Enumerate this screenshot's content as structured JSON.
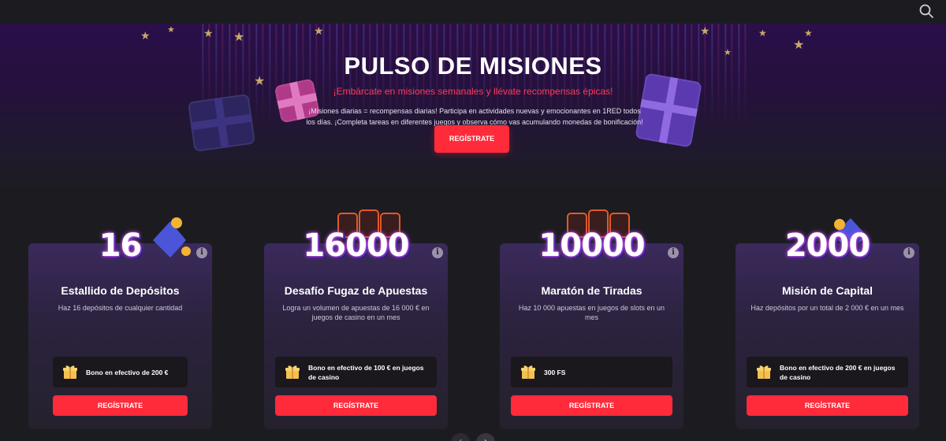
{
  "icons": {
    "search": "search-icon",
    "info": "info-icon",
    "gift": "gift-icon",
    "chevron_left": "chevron-left-icon",
    "chevron_right": "chevron-right-icon"
  },
  "colors": {
    "accent": "#ff2b3a",
    "subtitle": "#ff3b5c",
    "background": "#1c1c20",
    "hero_top": "#2a0f4a"
  },
  "hero": {
    "title": "PULSO DE MISIONES",
    "subtitle": "¡Embárcate en misiones semanales y llévate recompensas épicas!",
    "description": "¡Misiones diarias = recompensas diarias! Participa en actividades nuevas y emocionantes en 1RED todos los días. ¡Completa tareas en diferentes juegos y observa cómo vas acumulando monedas de bonificación!",
    "cta_label": "REGÍSTRATE"
  },
  "missions": [
    {
      "badge": "16",
      "title": "Estallido de Depósitos",
      "description": "Haz 16 depósitos de cualquier cantidad",
      "reward": "Bono en efectivo de 200 €",
      "cta_label": "REGÍSTRATE"
    },
    {
      "badge": "16000",
      "title": "Desafío Fugaz de Apuestas",
      "description": "Logra un volumen de apuestas de 16 000 € en juegos de casino en un mes",
      "reward": "Bono en efectivo de 100 € en juegos de casino",
      "cta_label": "REGÍSTRATE"
    },
    {
      "badge": "10000",
      "title": "Maratón de Tiradas",
      "description": "Haz 10 000 apuestas en juegos de slots en un mes",
      "reward": "300 FS",
      "cta_label": "REGÍSTRATE"
    },
    {
      "badge": "2000",
      "title": "Misión de Capital",
      "description": "Haz depósitos por un total de 2 000 € en un mes",
      "reward": "Bono en efectivo de 200 € en juegos de casino",
      "cta_label": "REGÍSTRATE"
    }
  ]
}
